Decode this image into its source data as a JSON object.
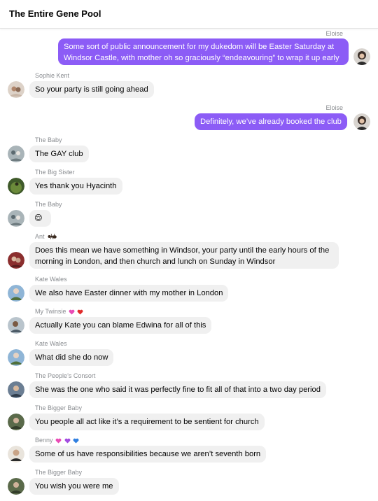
{
  "header": {
    "title": "The Entire Gene Pool"
  },
  "messages": [
    {
      "sender": "Eloise",
      "text": "Some sort of public announcement for my dukedom will be Easter Saturday at Windsor Castle, with mother oh so graciously “endeavouring” to wrap it up early"
    },
    {
      "sender": "Sophie Kent",
      "text": "So your party is still going ahead"
    },
    {
      "sender": "Eloise",
      "text": "Definitely, we’ve already booked the club"
    },
    {
      "sender": "The Baby",
      "text": "The GAY club"
    },
    {
      "sender": "The Big Sister",
      "text": "Yes thank you Hyacinth"
    },
    {
      "sender": "The Baby",
      "text": "😌"
    },
    {
      "sender": "Ant",
      "text": "Does this mean we have something in Windsor, your party until the early hours of the morning in London, and then church and lunch on Sunday in Windsor"
    },
    {
      "sender": "Kate Wales",
      "text": "We also have Easter dinner with my mother in London"
    },
    {
      "sender": "My Twinsie",
      "text": "Actually Kate you can blame Edwina for all of this"
    },
    {
      "sender": "Kate Wales",
      "text": "What did she do now"
    },
    {
      "sender": "The People’s Consort",
      "text": "She was the one who said it was perfectly fine to fit all of that into a two day period"
    },
    {
      "sender": "The Bigger Baby",
      "text": "You people all act like it’s a requirement to be sentient for church"
    },
    {
      "sender": "Benny",
      "text": "Some of us have responsibilities because we aren’t seventh born"
    },
    {
      "sender": "The Bigger Baby",
      "text": "You wish you were me"
    }
  ],
  "colors": {
    "outgoing_bubble": "#8c5cf6",
    "incoming_bubble": "#f0f0f0",
    "sender_name": "#8a8d91"
  },
  "icons": [
    "ant-emoji-icon",
    "pink-heart-icon",
    "red-heart-icon",
    "purple-heart-icon",
    "blue-heart-icon",
    "avatar"
  ]
}
